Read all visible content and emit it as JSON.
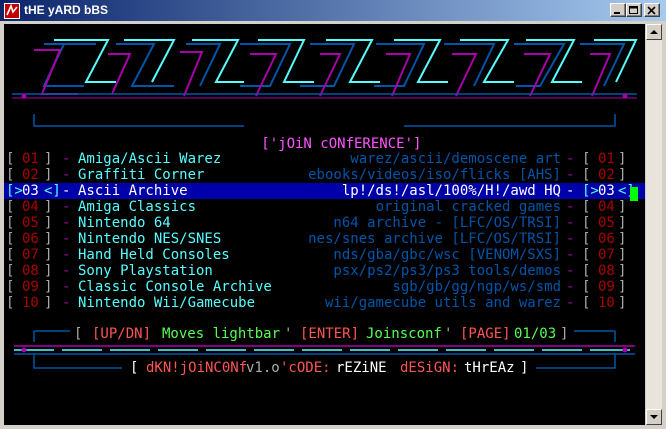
{
  "window": {
    "title": "tHE yARD bBS"
  },
  "header": {
    "category_title": "['jOiN cONfERENCE']"
  },
  "conferences": [
    {
      "num": "01",
      "name": "Amiga/Ascii Warez",
      "desc": "warez/ascii/demoscene art"
    },
    {
      "num": "02",
      "name": "Graffiti Corner",
      "desc": "ebooks/videos/iso/flicks [AHS]"
    },
    {
      "num": "03",
      "name": "Ascii Archive",
      "desc": "lp!/ds!/asl/100%/H!/awd HQ"
    },
    {
      "num": "04",
      "name": "Amiga Classics",
      "desc": "original cracked games"
    },
    {
      "num": "05",
      "name": "Nintendo 64",
      "desc": "n64 archive - [LFC/OS/TRSI]"
    },
    {
      "num": "06",
      "name": "Nintendo NES/SNES",
      "desc": "nes/snes archive [LFC/OS/TRSI]"
    },
    {
      "num": "07",
      "name": "Hand Held Consoles",
      "desc": "nds/gba/gbc/wsc [VENOM/SXS]"
    },
    {
      "num": "08",
      "name": "Sony Playstation",
      "desc": "psx/ps2/ps3/ps3 tools/demos"
    },
    {
      "num": "09",
      "name": "Classic Console Archive",
      "desc": "sgb/gb/gg/ngp/ws/smd"
    },
    {
      "num": "10",
      "name": "Nintendo Wii/Gamecube",
      "desc": "wii/gamecube utils and warez"
    }
  ],
  "selected_index": 2,
  "status": {
    "open": "[",
    "updn_key": "[UP/DN]",
    "updn_text": "Moves lightbar",
    "sep1": "'",
    "enter_key": "[ENTER]",
    "enter_text": "Joinsconf",
    "sep2": "'",
    "page_key": "[PAGE]",
    "page_value": "01/03",
    "close": "]"
  },
  "footer": {
    "open": "[",
    "name": "dKN!jOiNC0Nf",
    "version": "v1.o",
    "code_label": "'cODE:",
    "code_by": "rEZiNE",
    "design_label": "dESiGN:",
    "design_by": "tHrEAz",
    "close": "]"
  },
  "colors": {
    "selection_bar": "#0000aa",
    "cursor": "#00ff00",
    "logo_cyan": "#55ffff",
    "logo_magenta": "#aa00aa",
    "logo_blue": "#0055aa"
  }
}
